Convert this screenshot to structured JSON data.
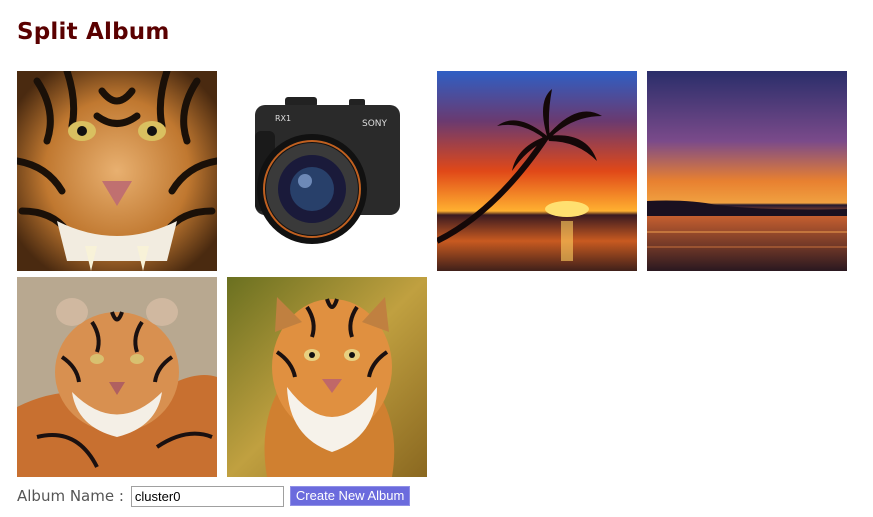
{
  "page": {
    "title": "Split Album"
  },
  "photos": [
    {
      "icon": "tiger-face-closeup-photo"
    },
    {
      "icon": "camera-product-photo"
    },
    {
      "icon": "palm-sunset-photo"
    },
    {
      "icon": "sea-sunset-photo"
    },
    {
      "icon": "tiger-painting-photo"
    },
    {
      "icon": "tiger-portrait-photo"
    }
  ],
  "form": {
    "label": "Album Name :",
    "album_name_value": "cluster0",
    "create_label": "Create New Album"
  },
  "colors": {
    "title": "#5a0000",
    "button_bg": "#6b6bdd",
    "button_text": "#ffffff"
  }
}
